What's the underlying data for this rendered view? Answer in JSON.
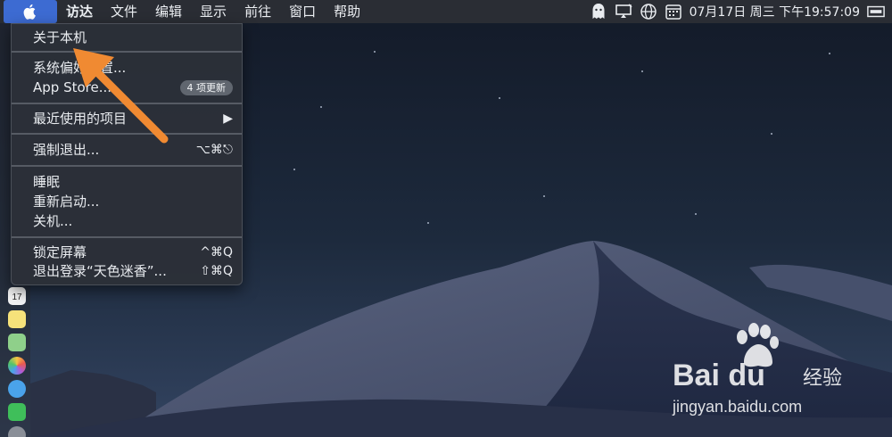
{
  "menubar": {
    "items": [
      "访达",
      "文件",
      "编辑",
      "显示",
      "前往",
      "窗口",
      "帮助"
    ],
    "datetime": "07月17日 周三 下午19:57:09",
    "calendar_day": "17"
  },
  "dropdown": {
    "about": "关于本机",
    "system_prefs": "系统偏好设置...",
    "app_store": "App Store...",
    "app_store_badge": "4 项更新",
    "recent_items": "最近使用的项目",
    "recent_items_arrow": "▶",
    "force_quit": "强制退出...",
    "force_quit_shortcut": "⌥⌘⎋",
    "sleep": "睡眠",
    "restart": "重新启动...",
    "shutdown": "关机...",
    "lock_screen": "锁定屏幕",
    "lock_screen_shortcut": "^⌘Q",
    "logout": "退出登录“天色迷香”...",
    "logout_shortcut": "⇧⌘Q"
  },
  "dock": {
    "calendar_day": "17"
  },
  "watermark": {
    "brand": "Bai du",
    "label": "经验",
    "url": "jingyan.baidu.com"
  },
  "colors": {
    "menubar_bg": "#2a2d34",
    "apple_highlight": "#3d6bd2",
    "arrow": "#f08a32"
  }
}
